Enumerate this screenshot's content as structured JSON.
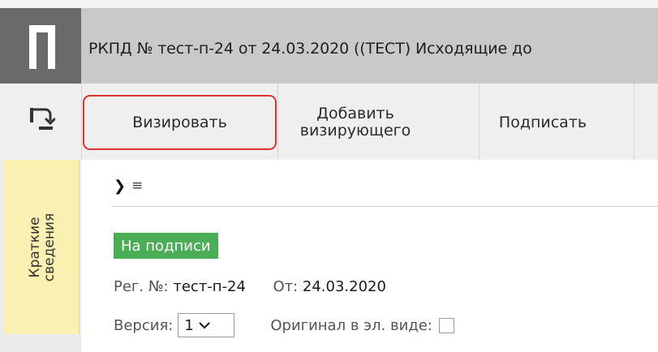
{
  "header": {
    "window_title": "РКПД №  тест-п-24 от 24.03.2020 ((ТЕСТ) Исходящие до"
  },
  "icons": {
    "app_logo": "app-logo-p",
    "back": "return-arrow-icon",
    "expander": "chevron-right-icon",
    "menu": "hamburger-icon",
    "dropdown": "chevron-down-icon"
  },
  "toolbar": {
    "visirovat_label": "Визировать",
    "add_visir_label_line1": "Добавить",
    "add_visir_label_line2": "визирующего",
    "sign_label": "Подписать"
  },
  "sidebar": {
    "tab_line1": "Краткие",
    "tab_line2": "сведения"
  },
  "content": {
    "expander_glyph": "❯",
    "menu_glyph": "≡",
    "status": "На подписи",
    "reg_label": "Рег. №:",
    "reg_value": "тест-п-24",
    "date_label": "От:",
    "date_value": "24.03.2020",
    "version_label": "Версия:",
    "version_value": "1",
    "original_label": "Оригинал в эл. виде:"
  },
  "colors": {
    "titlebar": "#c9c9c9",
    "logo_bg": "#6a6a6a",
    "highlight_border": "#e0322f",
    "status_badge": "#4cad57",
    "side_tab": "#faf0b2"
  }
}
